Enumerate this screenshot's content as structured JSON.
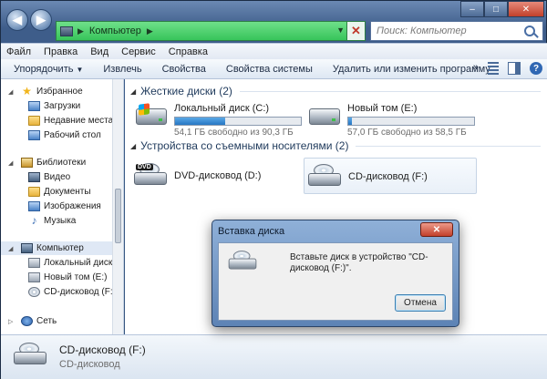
{
  "window": {
    "address": {
      "path": "Компьютер"
    },
    "search": {
      "placeholder": "Поиск: Компьютер"
    }
  },
  "menu": [
    "Файл",
    "Правка",
    "Вид",
    "Сервис",
    "Справка"
  ],
  "toolbar": {
    "organize": "Упорядочить",
    "eject": "Извлечь",
    "properties": "Свойства",
    "system_properties": "Свойства системы",
    "uninstall": "Удалить или изменить программу",
    "more": "»"
  },
  "sidebar": {
    "favorites": {
      "label": "Избранное",
      "items": [
        "Загрузки",
        "Недавние места",
        "Рабочий стол"
      ]
    },
    "libraries": {
      "label": "Библиотеки",
      "items": [
        "Видео",
        "Документы",
        "Изображения",
        "Музыка"
      ]
    },
    "computer": {
      "label": "Компьютер",
      "items": [
        "Локальный диск (C:)",
        "Новый том (E:)",
        "CD-дисковод (F:)"
      ]
    },
    "network": {
      "label": "Сеть"
    }
  },
  "content": {
    "hard_disks": {
      "header": "Жесткие диски (2)",
      "drives": [
        {
          "name": "Локальный диск (C:)",
          "free_text": "54,1 ГБ свободно из 90,3 ГБ",
          "used_fraction": 0.4
        },
        {
          "name": "Новый том (E:)",
          "free_text": "57,0 ГБ свободно из 58,5 ГБ",
          "used_fraction": 0.026
        }
      ]
    },
    "removable": {
      "header": "Устройства со съемными носителями (2)",
      "devices": [
        {
          "name": "DVD-дисковод (D:)",
          "badge": "DVD"
        },
        {
          "name": "CD-дисковод (F:)"
        }
      ]
    }
  },
  "details": {
    "name": "CD-дисковод (F:)",
    "type": "CD-дисковод"
  },
  "dialog": {
    "title": "Вставка диска",
    "message": "Вставьте диск в устройство \"CD-дисковод (F:)\".",
    "cancel": "Отмена"
  },
  "colors": {
    "address_bar": "#37c45a",
    "capacity_bar": "#2677c4",
    "dialog_frame": "#5d83b5"
  }
}
